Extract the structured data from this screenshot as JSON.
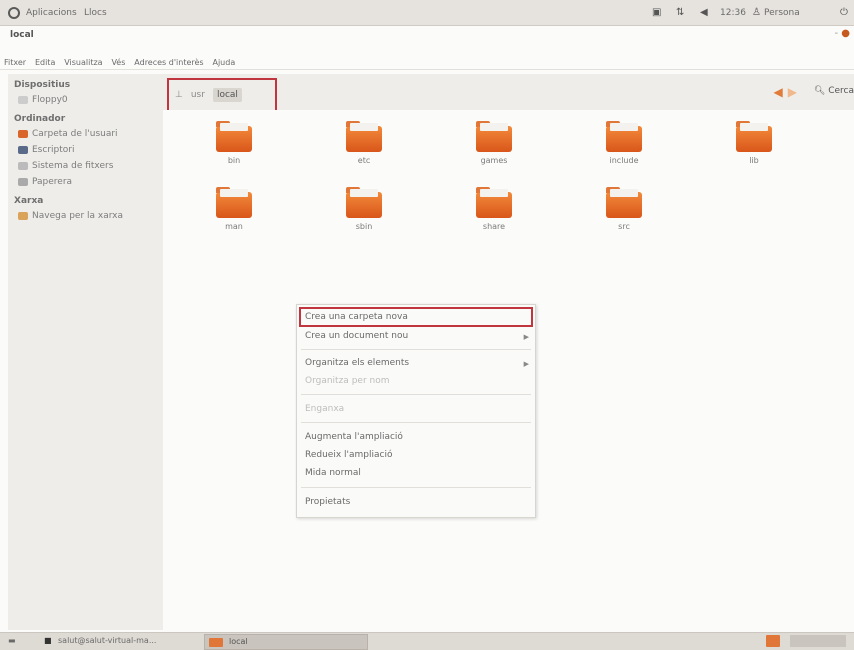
{
  "top_panel": {
    "applications": "Aplicacions",
    "places": "Llocs",
    "icons": [
      "network-icon",
      "sort-icon",
      "volume-icon"
    ],
    "time": "12:36",
    "user": "Persona"
  },
  "window": {
    "title": "local"
  },
  "menubar": [
    "Fitxer",
    "Edita",
    "Visualitza",
    "Vés",
    "Adreces d'interès",
    "Ajuda"
  ],
  "sidebar": {
    "sections": [
      {
        "title": "Dispositius",
        "items": [
          {
            "label": "Floppy0",
            "icon": "floppy-icon"
          }
        ]
      },
      {
        "title": "Ordinador",
        "items": [
          {
            "label": "Carpeta de l'usuari",
            "icon": "home-folder-icon"
          },
          {
            "label": "Escriptori",
            "icon": "desktop-icon"
          },
          {
            "label": "Sistema de fitxers",
            "icon": "filesystem-icon"
          },
          {
            "label": "Paperera",
            "icon": "trash-icon"
          }
        ]
      },
      {
        "title": "Xarxa",
        "items": [
          {
            "label": "Navega per la xarxa",
            "icon": "network-browse-icon"
          }
        ]
      }
    ]
  },
  "location": {
    "crumbs": [
      "usr",
      "local"
    ],
    "search": "Cerca"
  },
  "folders": [
    "bin",
    "etc",
    "games",
    "include",
    "lib",
    "man",
    "sbin",
    "share",
    "src"
  ],
  "context_menu": {
    "items": [
      {
        "label": "Crea una carpeta nova",
        "disabled": false,
        "submenu": false
      },
      {
        "label": "Crea un document nou",
        "disabled": false,
        "submenu": true
      },
      {
        "label": "Organitza els elements",
        "disabled": false,
        "submenu": true
      },
      {
        "label": "Organitza per nom",
        "disabled": true,
        "submenu": false
      },
      {
        "label": "Enganxa",
        "disabled": true,
        "submenu": false
      },
      {
        "label": "Augmenta l'ampliació",
        "disabled": false,
        "submenu": false
      },
      {
        "label": "Redueix l'ampliació",
        "disabled": false,
        "submenu": false
      },
      {
        "label": "Mida normal",
        "disabled": false,
        "submenu": false
      },
      {
        "label": "Propietats",
        "disabled": false,
        "submenu": false
      }
    ]
  },
  "taskbar": {
    "task1": "salut@salut-virtual-ma...",
    "task2": "local"
  },
  "colors": {
    "accent": "#e07738",
    "highlight_border": "#c0353e"
  }
}
